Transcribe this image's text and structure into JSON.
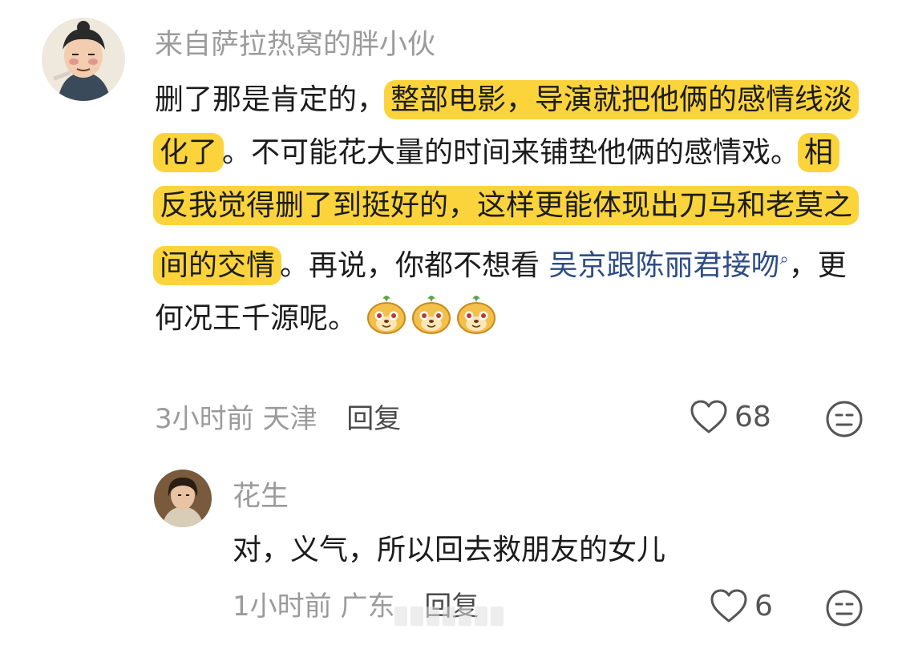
{
  "comment1": {
    "username": "来自萨拉热窝的胖小伙",
    "segments": [
      {
        "text": "删了那是肯定的，",
        "style": "plain"
      },
      {
        "text": "整部电影，导演就把他俩的感情线淡化了",
        "style": "highlight"
      },
      {
        "text": "。不可能花大量的时间来铺垫他俩的感情戏。",
        "style": "plain"
      },
      {
        "text": "相反我觉得删了到挺好的，这样更能体现出刀马和老莫之间的交情",
        "style": "highlight"
      },
      {
        "text": "。再说，你都不想看 ",
        "style": "plain"
      },
      {
        "text": "吴京跟陈丽君接吻",
        "style": "link"
      },
      {
        "text": "，更何况王千源呢。",
        "style": "plain"
      }
    ],
    "time": "3小时前",
    "location": "天津",
    "reply_label": "回复",
    "like_count": "68"
  },
  "comment2": {
    "username": "花生",
    "text": "对，义气，所以回去救朋友的女儿",
    "time": "1小时前",
    "location": "广东",
    "reply_label": "回复",
    "like_count": "6"
  },
  "colors": {
    "highlight": "#fbd43c",
    "link": "#2d4c86",
    "meta": "#9b9b9b"
  }
}
